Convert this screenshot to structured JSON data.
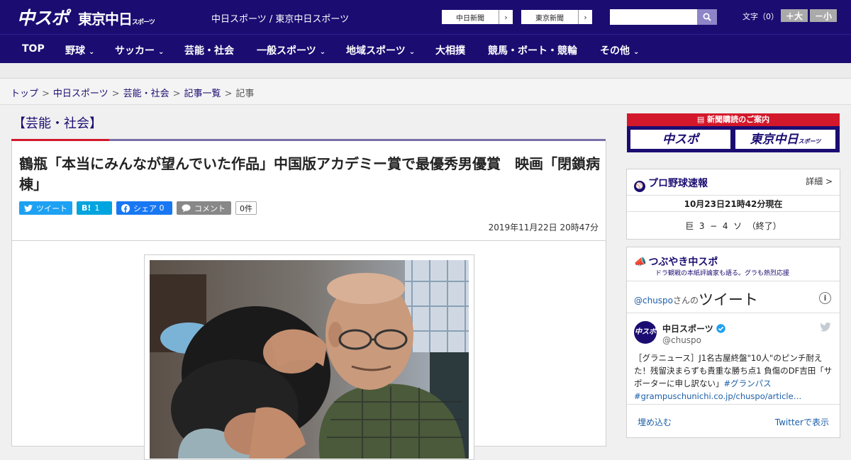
{
  "header": {
    "logo_chuspo": "中スポ",
    "logo_tokyo": "東京中日",
    "logo_tokyo_small": "スポーツ",
    "site_name": "中日スポーツ / 東京中日スポーツ",
    "links": [
      "中日新聞",
      "東京新聞"
    ],
    "arrow": "›",
    "search_placeholder": "",
    "font_label": "文字（0）",
    "font_larger": "＋大",
    "font_smaller": "－小"
  },
  "nav": {
    "items": [
      {
        "label": "TOP",
        "chevron": false
      },
      {
        "label": "野球",
        "chevron": true
      },
      {
        "label": "サッカー",
        "chevron": true
      },
      {
        "label": "芸能・社会",
        "chevron": false
      },
      {
        "label": "一般スポーツ",
        "chevron": true
      },
      {
        "label": "地域スポーツ",
        "chevron": true
      },
      {
        "label": "大相撲",
        "chevron": false
      },
      {
        "label": "競馬・ボート・競輪",
        "chevron": false
      },
      {
        "label": "その他",
        "chevron": true
      }
    ]
  },
  "breadcrumb": {
    "items": [
      "トップ",
      "中日スポーツ",
      "芸能・社会",
      "記事一覧"
    ],
    "current": "記事",
    "separator": ">"
  },
  "article": {
    "category": "【芸能・社会】",
    "headline": "鶴瓶「本当にみんなが望んでいた作品」中国版アカデミー賞で最優秀男優賞　映画「閉鎖病棟」",
    "share": {
      "tweet": "ツイート",
      "hatena_icon": "B!",
      "hatena_count": "1",
      "facebook": "シェア",
      "facebook_count": "0",
      "comment": "コメント",
      "comment_count": "0件"
    },
    "date": "2019年11月22日 20時47分"
  },
  "sidebar": {
    "subscribe_title": "新聞購読のご案内",
    "subscribe_chuspo": "中スポ",
    "subscribe_tokyo": "東京中日",
    "subscribe_tokyo_small": "スポーツ",
    "baseball": {
      "title": "プロ野球速報",
      "detail": "詳細 >",
      "time": "10月23日21時42分現在",
      "score": "巨  3  −  4  ソ  （終了）"
    },
    "tweets": {
      "title": "つぶやき中スポ",
      "subtitle": "ドラ観戦の本紙評論家も語る。グラも熱烈応援",
      "handle_link": "@chuspo",
      "handle_suffix": "さんの",
      "tweets_word": "ツイート",
      "account_name": "中日スポーツ",
      "account_handle": "@chuspo",
      "avatar_text": "中スポ",
      "tweet_text": "［グラニュース］J1名古屋終盤\"10人\"のピンチ耐えた！残留決まらずも貴重な勝ち点1 負傷のDF吉田「サポーターに申し訳ない」",
      "hashtag": "#グランパス",
      "link": "#grampuschunichi.co.jp/chuspo/article…",
      "embed": "埋め込む",
      "view_on_twitter": "Twitterで表示"
    }
  },
  "colors": {
    "brand_navy": "#1b0c72",
    "accent_red": "#d3182b",
    "twitter_blue": "#1da1f2",
    "hatena_blue": "#00a4de",
    "facebook_blue": "#1877f2"
  }
}
